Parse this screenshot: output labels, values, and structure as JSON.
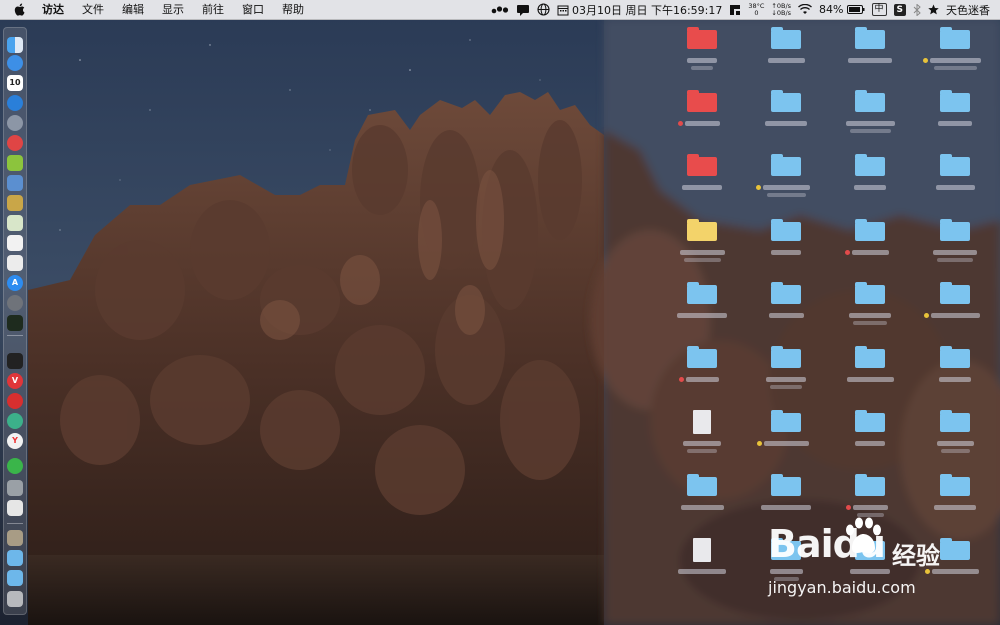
{
  "menubar": {
    "app_name": "访达",
    "menus": [
      "文件",
      "编辑",
      "显示",
      "前往",
      "窗口",
      "帮助"
    ],
    "status": {
      "date_time": "03月10日 周日 下午16:59:17",
      "temperature": "38°C",
      "temperature_value": "0",
      "net_up": "↑0B/s",
      "net_down": "↓0B/s",
      "battery": "84%",
      "input_method": "中",
      "user_name": "天色迷香"
    }
  },
  "watermark": {
    "brand_logo": "Baidu",
    "brand_cn": "经验",
    "url": "jingyan.baidu.com"
  },
  "colors": {
    "menubar_bg": "#eeeef0",
    "folder_blue": "#7cc4ef",
    "folder_red": "#e84c4c",
    "folder_yellow": "#f3d36a"
  },
  "dock": {
    "icons": [
      "finder-icon",
      "safari-icon",
      "calendar-icon",
      "compass-icon",
      "launchpad-icon",
      "app-red-icon",
      "android-icon",
      "preview-icon",
      "notes-icon",
      "maps-icon",
      "textedit-icon",
      "file-icon",
      "appstore-icon",
      "system-preferences-icon",
      "activity-monitor-icon",
      "terminal-icon",
      "vivaldi-icon",
      "netease-music-icon",
      "sync-icon",
      "yandex-icon",
      "wechat-icon",
      "automator-icon",
      "script-editor-icon",
      "archive-utility-icon",
      "downloads-folder-icon",
      "documents-folder-icon",
      "trash-icon"
    ]
  }
}
